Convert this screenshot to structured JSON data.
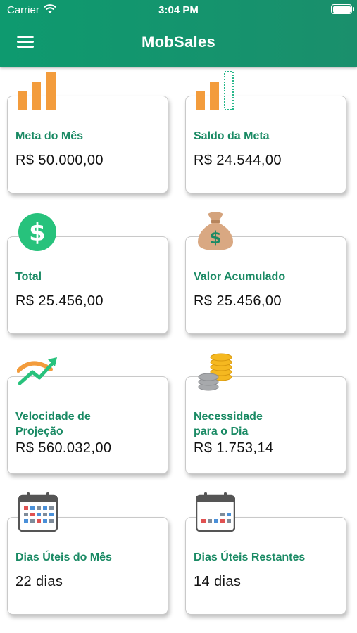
{
  "status_bar": {
    "carrier": "Carrier",
    "time": "3:04 PM"
  },
  "header": {
    "title": "MobSales"
  },
  "cards": [
    {
      "label": "Meta do Mês",
      "value": "R$ 50.000,00",
      "icon": "bar-chart-icon"
    },
    {
      "label": "Saldo da Meta",
      "value": "R$ 24.544,00",
      "icon": "partial-bar-chart-icon"
    },
    {
      "label": "Total",
      "value": "R$ 25.456,00",
      "icon": "dollar-circle-icon"
    },
    {
      "label": "Valor Acumulado",
      "value": "R$ 25.456,00",
      "icon": "money-bag-icon"
    },
    {
      "label_line1": "Velocidade de",
      "label_line2": "Projeção",
      "value": "R$ 560.032,00",
      "icon": "trend-up-icon"
    },
    {
      "label_line1": "Necessidade",
      "label_line2": "para o Dia",
      "value": "R$ 1.753,14",
      "icon": "coin-stack-icon"
    },
    {
      "label": "Dias Úteis do Mês",
      "value": "22 dias",
      "icon": "calendar-icon"
    },
    {
      "label": "Dias Úteis Restantes",
      "value": "14 dias",
      "icon": "calendar-partial-icon"
    }
  ],
  "colors": {
    "primary": "#0e9a6f",
    "label": "#1a8a64",
    "orange": "#f39c3c",
    "green_icon": "#27c27c"
  }
}
